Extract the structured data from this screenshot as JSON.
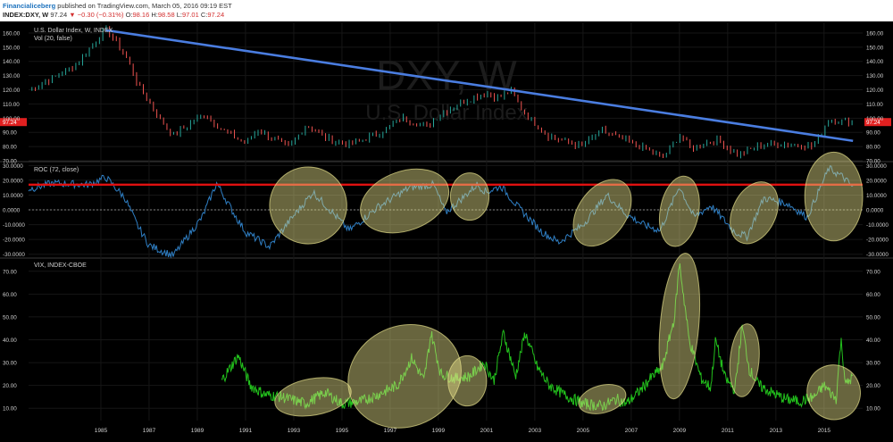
{
  "header": {
    "author": "Financialiceberg",
    "published": "published on TradingView.com, March 05, 2016 09:19 EST",
    "symbol": "INDEX:DXY, W",
    "last": "97.24",
    "change": "−0.30 (−0.31%)",
    "open_label": "O:",
    "open": "98.16",
    "high_label": "H:",
    "high": "98.58",
    "low_label": "L:",
    "low": "97.01",
    "close_label": "C:",
    "close": "97.24"
  },
  "colors": {
    "background": "#000000",
    "trendline": "#4a7de0",
    "roc_line": "#2f7fc4",
    "red_level": "#e01010",
    "vix_line": "#22c01c",
    "ellipse_fill": "#e6e08a",
    "candle_up": "#26a69a",
    "candle_down": "#ef5350"
  },
  "chart_data": [
    {
      "type": "line",
      "title": "U.S. Dollar Index, W, INDEX",
      "subtitle": "Vol (20, false)",
      "watermark": "DXY, W",
      "watermark_sub": "U.S. Dollar Index",
      "last_value_tag": "97.24",
      "ylim": [
        70,
        165
      ],
      "y_ticks": [
        "70.00",
        "80.00",
        "90.00",
        "100.00",
        "110.00",
        "120.00",
        "130.00",
        "140.00",
        "150.00",
        "160.00"
      ],
      "series": [
        {
          "name": "",
          "x": [
            1982.0,
            1983.0,
            1984.0,
            1985.2,
            1986.0,
            1986.5,
            1987.5,
            1988.0,
            1989.3,
            1990.0,
            1991.0,
            1991.5,
            1992.8,
            1993.5,
            1994.5,
            1995.3,
            1996.5,
            1997.5,
            1998.5,
            1999.0,
            2000.0,
            2001.0,
            2001.5,
            2002.0,
            2002.5,
            2003.5,
            2004.9,
            2005.8,
            2006.5,
            2007.5,
            2008.3,
            2009.0,
            2009.5,
            2010.5,
            2011.4,
            2012.5,
            2013.5,
            2014.5,
            2015.2,
            2016.2
          ],
          "values": [
            120,
            128,
            138,
            163,
            145,
            125,
            98,
            88,
            103,
            92,
            82,
            92,
            79,
            95,
            85,
            81,
            89,
            100,
            94,
            102,
            112,
            118,
            114,
            120,
            105,
            88,
            80,
            91,
            86,
            79,
            72,
            88,
            79,
            85,
            74,
            82,
            82,
            80,
            99,
            97.24
          ]
        },
        {
          "name": "",
          "kind": "trendline",
          "x": [
            1985.2,
            2016.2
          ],
          "values": [
            162,
            84
          ]
        }
      ]
    },
    {
      "type": "line",
      "title": "ROC (72, close)",
      "ylim": [
        -32,
        32
      ],
      "y_ticks": [
        "-30.0000",
        "-20.0000",
        "-10.0000",
        "0.0000",
        "10.0000",
        "20.0000",
        "30.0000"
      ],
      "reference_level": 17,
      "zero_line": 0,
      "series": [
        {
          "name": "",
          "x": [
            1982.0,
            1983.0,
            1984.5,
            1985.2,
            1986.0,
            1986.5,
            1987.0,
            1988.0,
            1989.2,
            1989.8,
            1990.5,
            1991.0,
            1992.0,
            1992.8,
            1993.8,
            1994.5,
            1995.3,
            1996.5,
            1997.8,
            1998.8,
            1999.3,
            2000.0,
            2000.6,
            2001.0,
            2001.6,
            2002.3,
            2003.3,
            2004.0,
            2005.0,
            2006.0,
            2006.8,
            2007.5,
            2008.2,
            2009.0,
            2009.6,
            2010.3,
            2011.3,
            2011.8,
            2012.5,
            2013.5,
            2014.3,
            2015.2,
            2015.8,
            2016.2
          ],
          "values": [
            14,
            18,
            17,
            22,
            8,
            -10,
            -24,
            -31,
            -5,
            18,
            -2,
            -15,
            -25,
            -8,
            12,
            0,
            -14,
            2,
            15,
            17,
            -2,
            8,
            17,
            12,
            16,
            2,
            -15,
            -22,
            -10,
            10,
            -3,
            -10,
            -14,
            16,
            -5,
            3,
            -15,
            -18,
            8,
            4,
            -5,
            28,
            22,
            15
          ]
        }
      ]
    },
    {
      "type": "line",
      "title": "VIX, INDEX-CBOE",
      "ylim": [
        5,
        75
      ],
      "y_ticks": [
        "10.00",
        "20.00",
        "30.00",
        "40.00",
        "50.00",
        "60.00",
        "70.00"
      ],
      "series": [
        {
          "name": "",
          "x": [
            1990.0,
            1990.7,
            1991.2,
            1991.8,
            1992.5,
            1993.5,
            1994.3,
            1995.0,
            1995.8,
            1996.5,
            1997.3,
            1997.9,
            1998.4,
            1998.7,
            1999.1,
            1999.7,
            2000.3,
            2000.9,
            2001.3,
            2001.7,
            2002.2,
            2002.6,
            2003.1,
            2003.6,
            2004.2,
            2005.0,
            2005.8,
            2006.4,
            2006.8,
            2007.3,
            2007.8,
            2008.3,
            2008.8,
            2009.0,
            2009.4,
            2009.9,
            2010.3,
            2010.5,
            2010.9,
            2011.3,
            2011.6,
            2011.9,
            2012.3,
            2012.8,
            2013.4,
            2014.0,
            2014.6,
            2015.0,
            2015.5,
            2015.7,
            2015.9,
            2016.2
          ],
          "values": [
            22,
            33,
            20,
            16,
            15,
            12,
            17,
            12,
            13,
            16,
            20,
            32,
            22,
            43,
            25,
            23,
            24,
            30,
            22,
            43,
            24,
            43,
            28,
            20,
            16,
            12,
            11,
            14,
            12,
            17,
            23,
            28,
            50,
            74,
            40,
            23,
            19,
            40,
            23,
            18,
            46,
            27,
            20,
            17,
            14,
            13,
            15,
            20,
            14,
            40,
            20,
            24
          ]
        }
      ]
    }
  ],
  "x_axis": {
    "ticks": [
      "1985",
      "1987",
      "1989",
      "1991",
      "1993",
      "1995",
      "1997",
      "1999",
      "2001",
      "2003",
      "2005",
      "2007",
      "2009",
      "2011",
      "2013",
      "2015"
    ]
  }
}
